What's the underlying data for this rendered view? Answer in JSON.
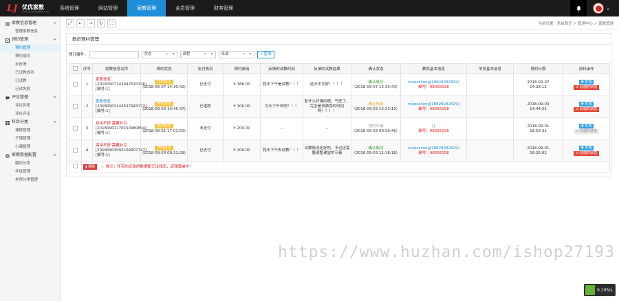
{
  "brand": {
    "logo_mark": "LJ",
    "name": "优优家教",
    "sub": "www.youyoujiajiao.com"
  },
  "topnav": [
    {
      "label": "系统管理"
    },
    {
      "label": "网站管理"
    },
    {
      "label": "家教管理",
      "active": true
    },
    {
      "label": "会员管理"
    },
    {
      "label": "财务管理"
    }
  ],
  "sidebar": [
    {
      "title": "家教信息管理",
      "icon": "list-icon",
      "items": [
        "管理家教信息"
      ]
    },
    {
      "title": "预约管理",
      "icon": "edit-icon",
      "items": [
        "预约管理",
        "预约成功",
        "未反馈",
        "已试教成功",
        "已试教",
        "已试失败"
      ],
      "active": "预约管理"
    },
    {
      "title": "评论管理",
      "icon": "comment-icon",
      "items": [
        "评论列表",
        "评价评论"
      ]
    },
    {
      "title": "科目分类",
      "icon": "grid-icon",
      "items": [
        "课程管理",
        "子课管理",
        "小课管理"
      ]
    },
    {
      "title": "家教数据配置",
      "icon": "gear-icon",
      "items": [
        "履历分类",
        "年级管理",
        "老师分类管理"
      ]
    }
  ],
  "toolbar": {
    "breadcrumb": "当前位置：系统首页 > 管理中心 > 家教管理"
  },
  "panel": {
    "title": "教员预约管理"
  },
  "filters": {
    "order_label": "预订编号：",
    "order_placeholder": "",
    "status_value": "状态",
    "type_value": "课程",
    "source_value": "来源",
    "search_label": "查询"
  },
  "table": {
    "headers": [
      "序号",
      "家教信息名称",
      "预约状态",
      "支付情况",
      "预约费用",
      "反馈的试教时间",
      "反馈的试教结果",
      "确认状态",
      "教员基本信息",
      "学员基本信息",
      "预约日期",
      "资料操作"
    ],
    "rows": [
      {
        "index": "1",
        "name_title": "家教信息",
        "name_code": "[20180907143042510326]",
        "name_owner": "[编号:1]",
        "status_badge": "预约成功",
        "status_time": "(2018-09-07 14:30:42)",
        "pay": "已支付",
        "fee": "¥ 388.00",
        "feedback_time": "我天下午是试教！！！",
        "feedback_result": "这天不太好！！！！",
        "confirm_label": "确认成功",
        "confirm_time": "（2018-09-07 15:33:43）",
        "teacher_name": "maoxeilong[18828282829]",
        "teacher_no": "编号：98058158",
        "student": "",
        "date": "2018-09-07",
        "date_time": "14:28:12",
        "action_primary": "处理",
        "action_secondary": "处理的状态"
      },
      {
        "index": "2",
        "name_title": "家教信息",
        "name_code": "[20180903144537943772]",
        "name_owner": "[编号:1]",
        "status_badge": "预约成功",
        "status_time": "(2018-09-03 14:45:37)",
        "pay": "已退款",
        "fee": "¥ 300.00",
        "feedback_time": "今天下午去吧！！！",
        "feedback_result": "有什么好课的啊，气死了，完全是浪费我的时间啊！！！！",
        "confirm_label": "确认失败",
        "confirm_time": "（2018-09-03 15:23:10）",
        "teacher_name": "maoxeilong[18828282829]",
        "teacher_no": "编号：98058158",
        "student": "",
        "date": "2018-09-03",
        "date_time": "14:44:55",
        "action_primary": "处理",
        "action_secondary": "处理的状态"
      },
      {
        "index": "3",
        "name_title": "初中不好 需要补习",
        "name_code": "[20180901170150980894]",
        "name_owner": "[编号:1]",
        "status_badge": "预约成功",
        "status_time": "(2018-09-01 17:01:50)",
        "pay": "未支付",
        "fee": "¥ 200.00",
        "feedback_time": "--",
        "feedback_result": "--",
        "confirm_label": "预约中请",
        "confirm_time": "（2018-09-03 09:20:46）",
        "teacher_name": "[]",
        "teacher_no": "编号：98058158",
        "student": "",
        "date": "2018-09-01",
        "date_time": "16:59:31",
        "action_primary": "处理",
        "action_secondary": "处理的状态"
      },
      {
        "index": "4",
        "name_title": "高中不好 需要补习",
        "name_code": "[20180903092109207747]",
        "name_owner": "[编号:1]",
        "status_badge": "预约成功",
        "status_time": "(2018-09-03 09:21:09)",
        "pay": "已支付",
        "fee": "¥ 200.00",
        "feedback_time": "我天下午去试教！！！",
        "feedback_result": "试教情况还好的，不过还需要调整课堂的节奏",
        "confirm_label": "确认成功",
        "confirm_time": "（2018-09-03 11:18:18）",
        "teacher_name": "maoxeilong[18828282829]",
        "teacher_no": "编号：98058158",
        "student": "",
        "date": "2018-09-01",
        "date_time": "16:26:02",
        "action_primary": "处理",
        "action_secondary": "处理的状态"
      }
    ],
    "delete_label": "删除",
    "warning": "提示：所有的记录的数据都无法找回，请谨慎操作！"
  },
  "watermark": "https://www.huzhan.com/ishop27193",
  "speed": "0.105/s",
  "colors": {
    "topbar": "#1b1b1b",
    "accent": "#1e8ed8",
    "danger": "#e02020",
    "success": "#2a9a2a",
    "warning": "#f6c242"
  }
}
